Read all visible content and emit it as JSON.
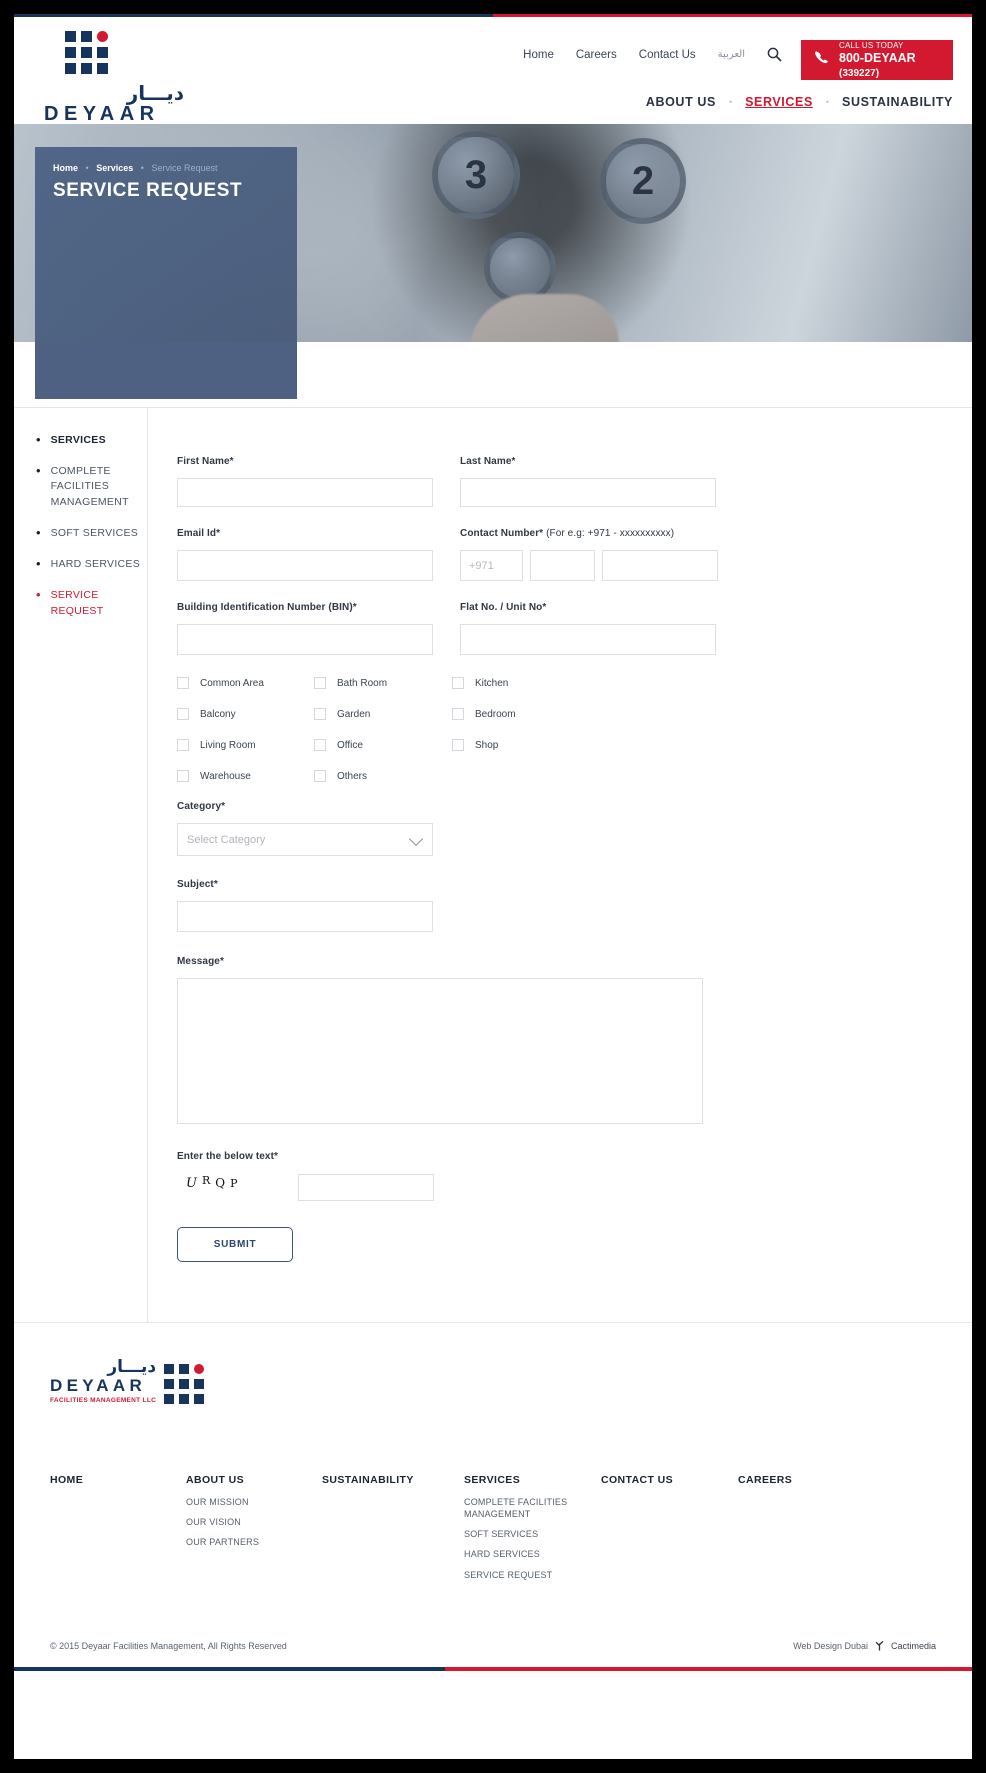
{
  "brand": {
    "name_arabic": "ديـــار",
    "name": "DEYAAR",
    "tagline": "FACILITIES MANAGEMENT LLC",
    "accent_red": "#d3192f",
    "accent_navy": "#17345c"
  },
  "header": {
    "top_nav": [
      {
        "label": "Home"
      },
      {
        "label": "Careers"
      },
      {
        "label": "Contact Us"
      },
      {
        "label": "العربية"
      }
    ],
    "search_icon": "search-icon",
    "call": {
      "icon": "phone-icon",
      "line1": "CALL US TODAY",
      "number": "800-DEYAAR",
      "digits": "(339227)"
    },
    "main_nav": [
      {
        "label": "ABOUT US",
        "active": false
      },
      {
        "label": "SERVICES",
        "active": true
      },
      {
        "label": "SUSTAINABILITY",
        "active": false
      }
    ],
    "nav_separator": "•"
  },
  "hero": {
    "breadcrumb": {
      "home": "Home",
      "services": "Services",
      "current": "Service Request",
      "separator": "•"
    },
    "title": "SERVICE REQUEST",
    "elevator_buttons": [
      "3",
      "2"
    ]
  },
  "sidebar": {
    "items": [
      {
        "label": "SERVICES",
        "style": "head"
      },
      {
        "label": "COMPLETE FACILITIES MANAGEMENT",
        "style": "normal"
      },
      {
        "label": "SOFT SERVICES",
        "style": "normal"
      },
      {
        "label": "HARD SERVICES",
        "style": "normal"
      },
      {
        "label": "SERVICE REQUEST",
        "style": "active"
      }
    ]
  },
  "form": {
    "first_name": {
      "label": "First Name*",
      "value": "",
      "placeholder": ""
    },
    "last_name": {
      "label": "Last Name*",
      "value": "",
      "placeholder": ""
    },
    "email": {
      "label": "Email Id*",
      "value": "",
      "placeholder": ""
    },
    "contact": {
      "label_bold": "Contact Number*",
      "label_note": " (For e.g: +971 - xxxxxxxxxx)",
      "country_code": "+971",
      "part2": "",
      "part3": ""
    },
    "bin": {
      "label": "Building Identification Number (BIN)*",
      "value": ""
    },
    "flat": {
      "label": "Flat No. / Unit No*",
      "value": ""
    },
    "checkboxes": [
      [
        {
          "label": "Common Area",
          "checked": false
        },
        {
          "label": "Bath Room",
          "checked": false
        },
        {
          "label": "Kitchen",
          "checked": false
        }
      ],
      [
        {
          "label": "Balcony",
          "checked": false
        },
        {
          "label": "Garden",
          "checked": false
        },
        {
          "label": "Bedroom",
          "checked": false
        }
      ],
      [
        {
          "label": "Living Room",
          "checked": false
        },
        {
          "label": "Office",
          "checked": false
        },
        {
          "label": "Shop",
          "checked": false
        }
      ],
      [
        {
          "label": "Warehouse",
          "checked": false
        },
        {
          "label": "Others",
          "checked": false
        }
      ]
    ],
    "category": {
      "label": "Category*",
      "selected": "Select Category"
    },
    "subject": {
      "label": "Subject*",
      "value": ""
    },
    "message": {
      "label": "Message*",
      "value": ""
    },
    "captcha": {
      "label": "Enter the below text*",
      "text": "URQP",
      "value": ""
    },
    "submit_label": "SUBMIT"
  },
  "footer": {
    "columns": [
      {
        "title": "HOME",
        "links": []
      },
      {
        "title": "ABOUT US",
        "links": [
          "OUR MISSION",
          "OUR VISION",
          "OUR PARTNERS"
        ]
      },
      {
        "title": "SUSTAINABILITY",
        "links": []
      },
      {
        "title": "SERVICES",
        "links": [
          "COMPLETE FACILITIES MANAGEMENT",
          "SOFT SERVICES",
          "HARD SERVICES",
          "SERVICE REQUEST"
        ]
      },
      {
        "title": "CONTACT US",
        "links": []
      },
      {
        "title": "CAREERS",
        "links": []
      }
    ],
    "copyright": "© 2015 Deyaar Facilities Management, All Rights Reserved",
    "credit_prefix": "Web Design Dubai",
    "credit_icon": "cactimedia-logo-icon",
    "credit_name": "Cactimedia"
  }
}
